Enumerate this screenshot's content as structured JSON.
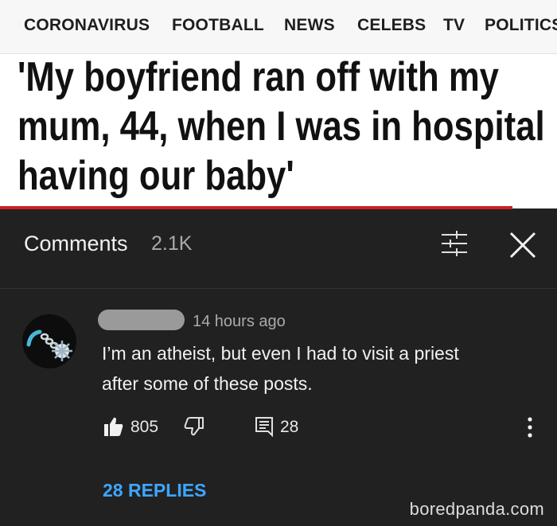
{
  "news": {
    "nav": [
      "CORONAVIRUS",
      "FOOTBALL",
      "NEWS",
      "CELEBS",
      "TV",
      "POLITICS"
    ],
    "headline_lines": [
      "'My boyfriend ran off with my",
      "mum, 44, when I was in hospital",
      "having our baby'"
    ],
    "accent_color": "#d01f1f"
  },
  "comments_panel": {
    "title": "Comments",
    "count": "2.1K",
    "icons": {
      "filter": "sort-filter-icon",
      "close": "close-icon"
    },
    "comment": {
      "time": "14 hours ago",
      "text_lines": [
        "I’m an atheist, but even I had to visit a priest",
        "after some of these posts."
      ],
      "likes": "805",
      "reply_count": "28",
      "replies_link": "28 REPLIES",
      "icons": {
        "like": "thumbs-up-icon",
        "dislike": "thumbs-down-icon",
        "reply": "reply-icon",
        "more": "more-vertical-icon",
        "avatar": "flail-avatar-icon"
      }
    },
    "link_color": "#3ea6ff"
  },
  "watermark": "boredpanda.com"
}
